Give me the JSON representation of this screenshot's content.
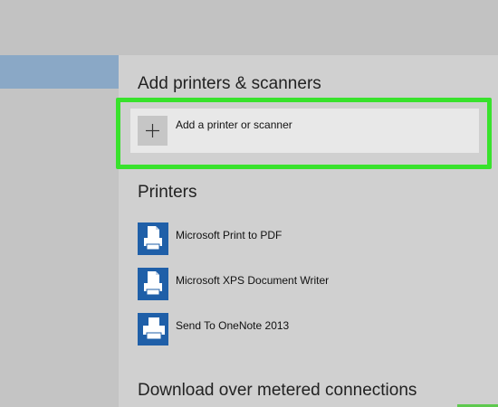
{
  "add_section": {
    "heading": "Add printers & scanners",
    "add_button_label": "Add a printer or scanner",
    "plus_icon": "+"
  },
  "printers_section": {
    "heading": "Printers",
    "items": [
      {
        "label": "Microsoft Print to PDF",
        "icon": "document-printer-icon"
      },
      {
        "label": "Microsoft XPS Document Writer",
        "icon": "document-printer-icon"
      },
      {
        "label": "Send To OneNote 2013",
        "icon": "printer-icon"
      }
    ]
  },
  "download_section": {
    "heading": "Download over metered connections"
  },
  "colors": {
    "highlight": "#38e22c",
    "icon_blue": "#1f5fa8",
    "sidebar_selected": "#8aa8c6"
  }
}
